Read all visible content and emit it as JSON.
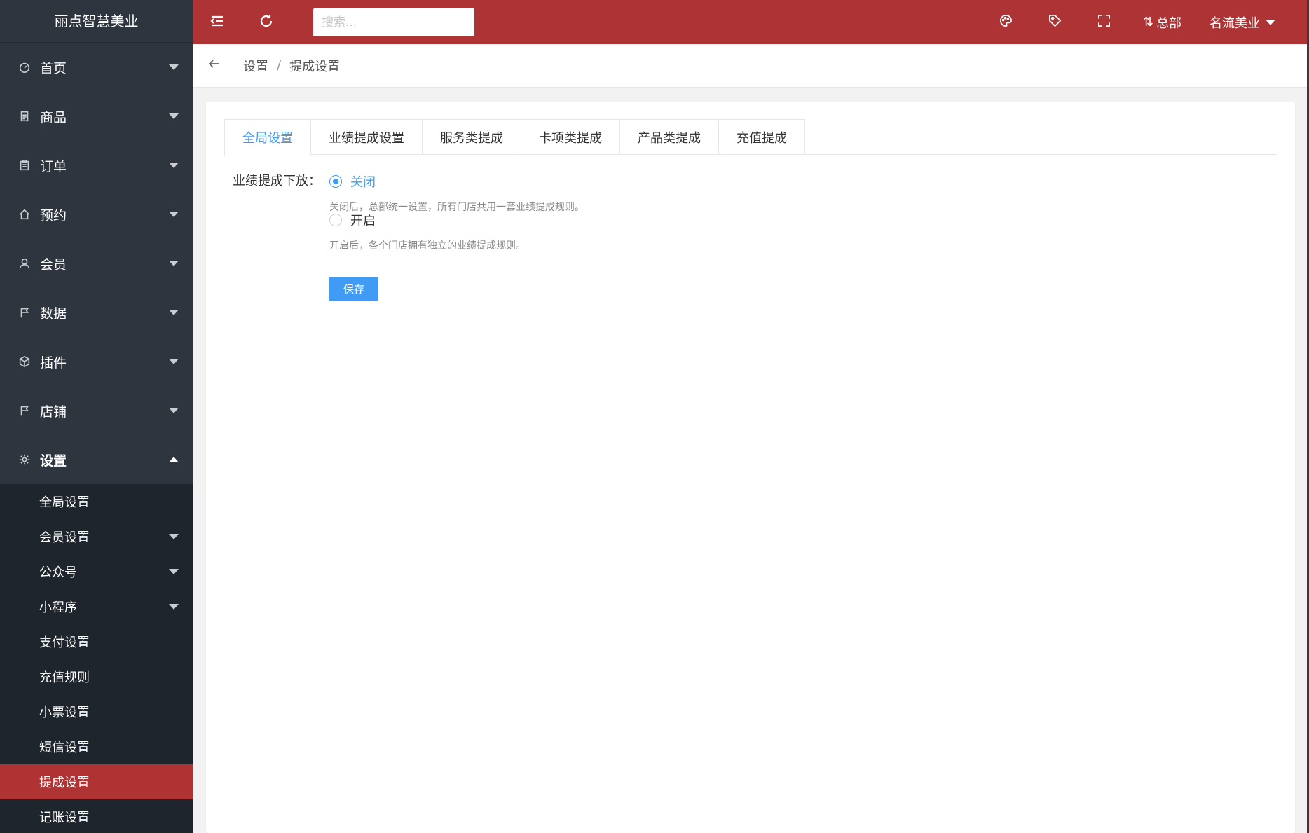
{
  "app": {
    "brand": "丽点智慧美业"
  },
  "sidebar": {
    "items": [
      {
        "label": "首页",
        "icon": "dashboard-icon"
      },
      {
        "label": "商品",
        "icon": "document-icon"
      },
      {
        "label": "订单",
        "icon": "clipboard-icon"
      },
      {
        "label": "预约",
        "icon": "home-icon"
      },
      {
        "label": "会员",
        "icon": "user-icon"
      },
      {
        "label": "数据",
        "icon": "flag-icon"
      },
      {
        "label": "插件",
        "icon": "cube-icon"
      },
      {
        "label": "店铺",
        "icon": "flag-icon"
      },
      {
        "label": "设置",
        "icon": "gear-icon"
      }
    ],
    "settings_sub": [
      {
        "label": "全局设置"
      },
      {
        "label": "会员设置"
      },
      {
        "label": "公众号"
      },
      {
        "label": "小程序"
      },
      {
        "label": "支付设置"
      },
      {
        "label": "充值规则"
      },
      {
        "label": "小票设置"
      },
      {
        "label": "短信设置"
      },
      {
        "label": "提成设置"
      },
      {
        "label": "记账设置"
      }
    ]
  },
  "topbar": {
    "search_placeholder": "搜索...",
    "hq_label": "总部",
    "user_label": "名流美业"
  },
  "breadcrumb": {
    "parent": "设置",
    "separator": "/",
    "current": "提成设置"
  },
  "tabs": [
    {
      "label": "全局设置"
    },
    {
      "label": "业绩提成设置"
    },
    {
      "label": "服务类提成"
    },
    {
      "label": "卡项类提成"
    },
    {
      "label": "产品类提成"
    },
    {
      "label": "充值提成"
    }
  ],
  "form": {
    "label": "业绩提成下放：",
    "option_close": "关闭",
    "hint_close": "关闭后，总部统一设置，所有门店共用一套业绩提成规则。",
    "option_open": "开启",
    "hint_open": "开启后，各个门店拥有独立的业绩提成规则。",
    "save_label": "保存",
    "selected": "关闭"
  },
  "colors": {
    "accent": "#3f9bf4",
    "topbar": "#ad3334",
    "sidebar": "#2e353f",
    "active_menu": "#b03334"
  }
}
